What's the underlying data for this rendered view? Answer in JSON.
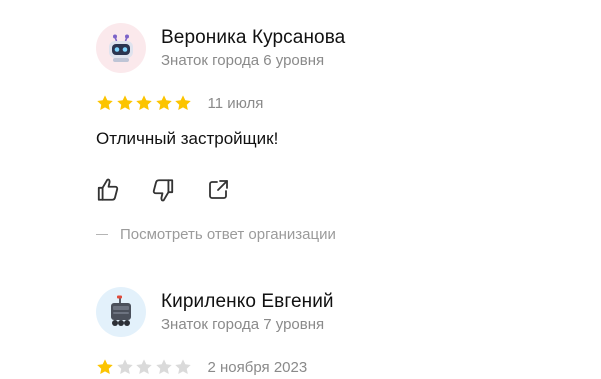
{
  "reviews": [
    {
      "author_name": "Вероника Курсанова",
      "author_level": "Знаток города 6 уровня",
      "avatar_icon": "robot-avatar-icon",
      "rating": 5,
      "rating_max": 5,
      "date": "11 июля",
      "text": "Отличный застройщик!",
      "org_answer_link": "Посмотреть ответ организации"
    },
    {
      "author_name": "Кириленко Евгений",
      "author_level": "Знаток города 7 уровня",
      "avatar_icon": "delivery-robot-avatar-icon",
      "rating": 1,
      "rating_max": 5,
      "date": "2 ноября 2023"
    }
  ],
  "colors": {
    "star_filled": "#fcc400",
    "star_empty": "#dadada",
    "muted_text": "#8a8a8a",
    "icon_stroke": "#333333"
  }
}
